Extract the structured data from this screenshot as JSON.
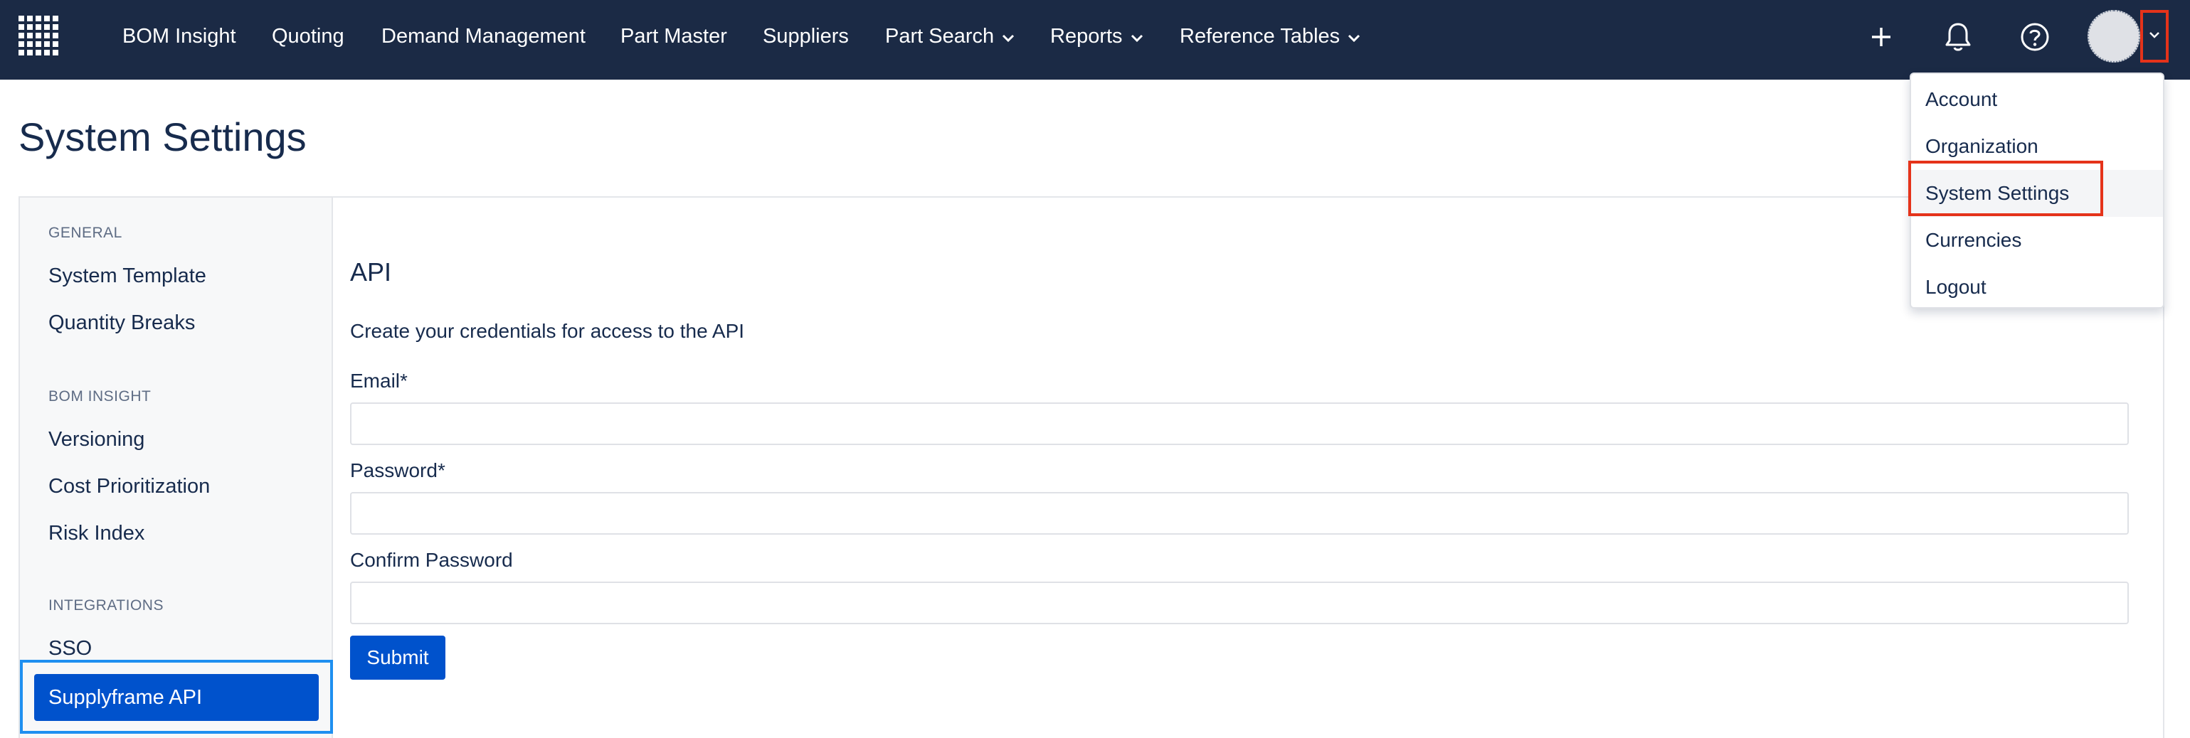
{
  "navbar": {
    "items": [
      {
        "label": "BOM Insight"
      },
      {
        "label": "Quoting"
      },
      {
        "label": "Demand Management"
      },
      {
        "label": "Part Master"
      },
      {
        "label": "Suppliers"
      },
      {
        "label": "Part Search",
        "has_dropdown": true
      },
      {
        "label": "Reports",
        "has_dropdown": true
      },
      {
        "label": "Reference Tables",
        "has_dropdown": true
      }
    ],
    "icons": [
      "plus-icon",
      "bell-icon",
      "help-icon"
    ]
  },
  "page": {
    "title": "System Settings"
  },
  "sidebar": {
    "sections": [
      {
        "label": "GENERAL",
        "items": [
          "System Template",
          "Quantity Breaks"
        ]
      },
      {
        "label": "BOM INSIGHT",
        "items": [
          "Versioning",
          "Cost Prioritization",
          "Risk Index"
        ]
      },
      {
        "label": "INTEGRATIONS",
        "items": [
          "SSO",
          "Supplyframe API"
        ]
      }
    ],
    "active": "Supplyframe API"
  },
  "content": {
    "title": "API",
    "description": "Create your credentials for access to the API",
    "fields": [
      {
        "label": "Email*",
        "value": ""
      },
      {
        "label": "Password*",
        "value": ""
      },
      {
        "label": "Confirm Password",
        "value": ""
      }
    ],
    "submit_label": "Submit"
  },
  "user_menu": {
    "items": [
      "Account",
      "Organization",
      "System Settings",
      "Currencies",
      "Logout"
    ],
    "highlighted": "System Settings"
  },
  "colors": {
    "navbar_bg": "#1b2a45",
    "primary": "#0052cc",
    "highlight_red": "#e5331a",
    "active_outline_blue": "#1e8ff0"
  }
}
